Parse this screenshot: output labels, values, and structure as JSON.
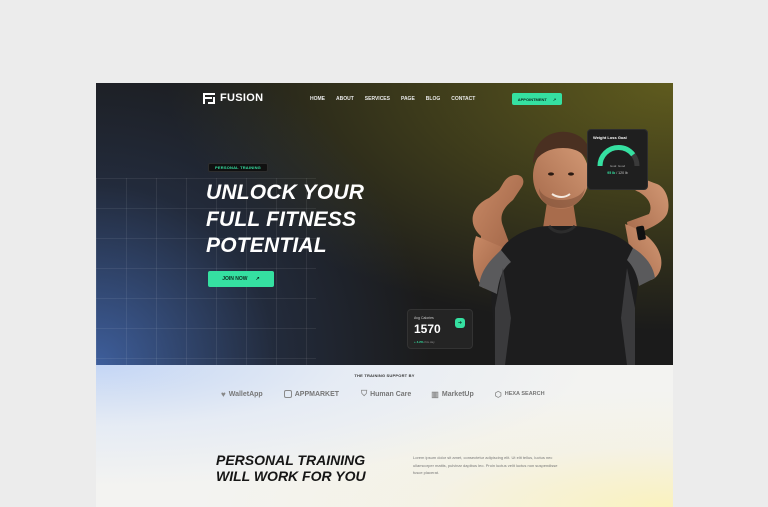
{
  "nav": {
    "logo": "FUSION",
    "links": [
      "HOME",
      "ABOUT",
      "SERVICES",
      "PAGE",
      "BLOG",
      "CONTACT"
    ],
    "cta": "APPOINTMENT",
    "cta_arrow": "↗"
  },
  "hero": {
    "tag": "PERSONAL TRAINING",
    "headline_1": "UNLOCK YOUR",
    "headline_2": "FULL FITNESS",
    "headline_3": "POTENTIAL",
    "button": "JOIN NOW",
    "button_arrow": "↗"
  },
  "weight_card": {
    "title": "Weight Loss Goal",
    "sub": "Goal: Good",
    "value_done": "95 lb",
    "value_total": "/ 120 lb",
    "progress": 0.79
  },
  "calorie_card": {
    "title": "Avg Calories",
    "value": "1570",
    "change": "+ 4.2%",
    "period": "this day"
  },
  "support": {
    "label": "THE TRAINING SUPPORT BY",
    "brands": [
      "WalletApp",
      "APPMARKET",
      "Human Care",
      "MarketUp",
      "HEXA SEARCH"
    ]
  },
  "section": {
    "title_1": "PERSONAL TRAINING",
    "title_2": "WILL WORK FOR YOU",
    "paragraph": "Lorem ipsum dolor sit amet, consectetur adipiscing elit. Ut elit tellus, luctus nec ullamcorper mattis, pulvinar dapibus leo. Proin luctus velit luctus non suspendisse fusce placerat."
  },
  "colors": {
    "accent": "#35e0a1",
    "hero_bg": "#1b1b1b",
    "lower_bg": "#f3f3f1"
  }
}
